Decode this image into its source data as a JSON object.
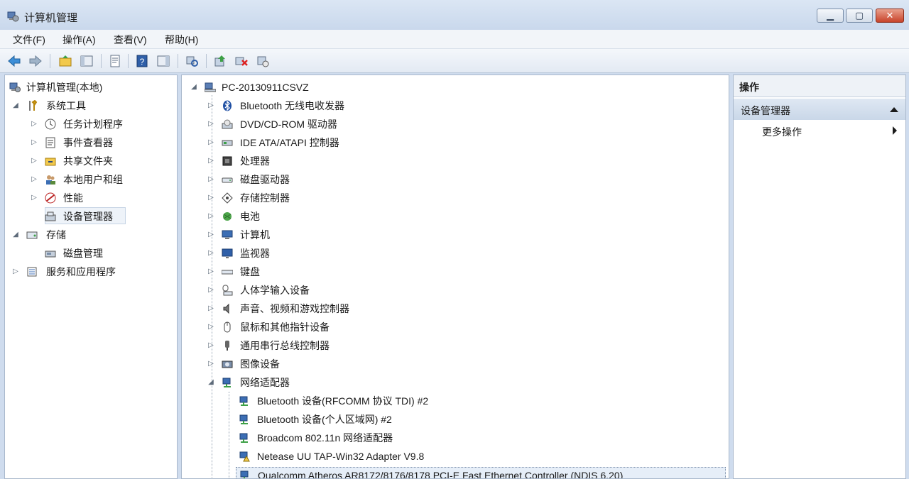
{
  "window": {
    "title": "计算机管理"
  },
  "menu": [
    "文件(F)",
    "操作(A)",
    "查看(V)",
    "帮助(H)"
  ],
  "left_tree": {
    "root": "计算机管理(本地)",
    "system_tools": "系统工具",
    "children": [
      "任务计划程序",
      "事件查看器",
      "共享文件夹",
      "本地用户和组",
      "性能",
      "设备管理器"
    ],
    "storage": "存储",
    "disk_management": "磁盘管理",
    "services": "服务和应用程序"
  },
  "device_tree": {
    "computer_name": "PC-20130911CSVZ",
    "categories": [
      "Bluetooth 无线电收发器",
      "DVD/CD-ROM 驱动器",
      "IDE ATA/ATAPI 控制器",
      "处理器",
      "磁盘驱动器",
      "存储控制器",
      "电池",
      "计算机",
      "监视器",
      "键盘",
      "人体学输入设备",
      "声音、视频和游戏控制器",
      "鼠标和其他指针设备",
      "通用串行总线控制器",
      "图像设备",
      "网络适配器"
    ],
    "network_adapters": [
      "Bluetooth 设备(RFCOMM 协议 TDI) #2",
      "Bluetooth 设备(个人区域网) #2",
      "Broadcom 802.11n 网络适配器",
      "Netease UU TAP-Win32 Adapter V9.8",
      "Qualcomm Atheros AR8172/8176/8178 PCI-E Fast Ethernet Controller (NDIS 6.20)"
    ]
  },
  "actions": {
    "header": "操作",
    "section": "设备管理器",
    "more": "更多操作"
  }
}
